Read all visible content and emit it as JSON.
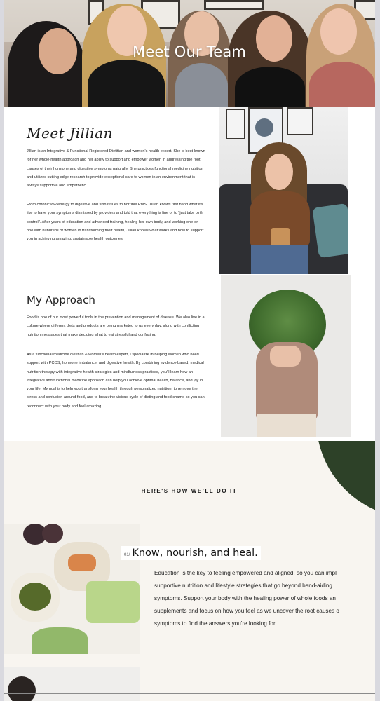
{
  "hero": {
    "title": "Meet Our Team"
  },
  "jillian": {
    "title": "Meet Jillian",
    "paragraphs": [
      "Jillian is an Integrative & Functional Registered Dietitian and women's health expert. She is best known for her whole-health approach and her ability to support and empower women in addressing the root causes of their hormone and digestive symptoms naturally. She practices functional medicine nutrition and utilizes cutting edge research to provide exceptional care to women in an environment that is always supportive and empathetic.",
      "From chronic low energy to digestive and skin issues to horrible PMS, Jillian knows first hand what it's like to have your symptoms dismissed by providers and told that everything is fine or to \"just take birth control\". After years of education and advanced training, healing her own body, and working one-on-one with hundreds of women in transforming their health, Jillian knows what works and how to support you in achieving amazing, sustainable health outcomes."
    ]
  },
  "approach": {
    "title": "My Approach",
    "paragraphs": [
      "Food is one of our most powerful tools in the prevention and management of disease. We also live in a culture where different diets and products are being marketed to us every day, along with conflicting nutrition messages that make deciding what to eat stressful and confusing.",
      "As a functional medicine dietitian & women's health expert, I specialize in helping women who need support with PCOS, hormone imbalance, and digestive health. By combining evidence-based, medical nutrition therapy with integrative health strategies and mindfulness practices, you'll learn how an integrative and functional medicine approach can help you achieve optimal health, balance, and joy in your life. My goal is to help you transform your health through personalized nutrition, to remove the stress and confusion around food, and to break the vicious cycle of dieting and food shame so you can reconnect with your body and feel amazing."
    ]
  },
  "how": {
    "kicker": "HERE'S HOW WE'LL DO IT",
    "step_number": "01/",
    "step_title": "Know, nourish, and heal.",
    "step_lines": [
      "Education is the key to feeling empowered and aligned, so you can impl",
      "supportive nutrition and lifestyle strategies that go beyond band-aiding",
      "symptoms. Support your body with the healing power of whole foods an",
      "supplements and focus on how you feel as we uncover the root causes o",
      "symptoms to find the answers you're looking for."
    ]
  },
  "colors": {
    "accent_green": "#2d4128",
    "cream": "#f8f5f0"
  }
}
